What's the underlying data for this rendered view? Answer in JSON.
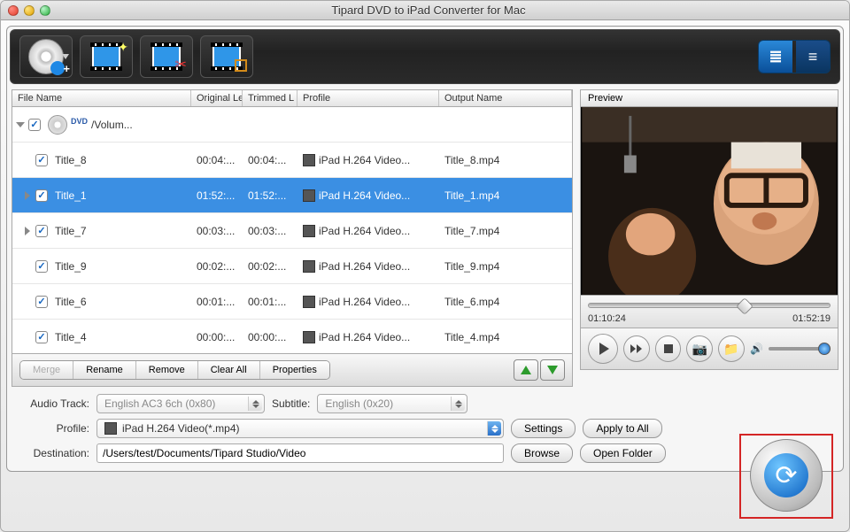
{
  "window": {
    "title": "Tipard DVD to iPad Converter for Mac"
  },
  "columns": {
    "fn": "File Name",
    "ol": "Original Le",
    "tl": "Trimmed L",
    "pf": "Profile",
    "on": "Output Name"
  },
  "parent": {
    "name": "/Volum..."
  },
  "rows": [
    {
      "name": "Title_8",
      "ol": "00:04:...",
      "tl": "00:04:...",
      "pf": "iPad H.264 Video...",
      "on": "Title_8.mp4",
      "sel": false,
      "exp": false
    },
    {
      "name": "Title_1",
      "ol": "01:52:...",
      "tl": "01:52:...",
      "pf": "iPad H.264 Video...",
      "on": "Title_1.mp4",
      "sel": true,
      "exp": true
    },
    {
      "name": "Title_7",
      "ol": "00:03:...",
      "tl": "00:03:...",
      "pf": "iPad H.264 Video...",
      "on": "Title_7.mp4",
      "sel": false,
      "exp": true
    },
    {
      "name": "Title_9",
      "ol": "00:02:...",
      "tl": "00:02:...",
      "pf": "iPad H.264 Video...",
      "on": "Title_9.mp4",
      "sel": false,
      "exp": false
    },
    {
      "name": "Title_6",
      "ol": "00:01:...",
      "tl": "00:01:...",
      "pf": "iPad H.264 Video...",
      "on": "Title_6.mp4",
      "sel": false,
      "exp": false
    },
    {
      "name": "Title_4",
      "ol": "00:00:...",
      "tl": "00:00:...",
      "pf": "iPad H.264 Video...",
      "on": "Title_4.mp4",
      "sel": false,
      "exp": false
    }
  ],
  "actions": {
    "merge": "Merge",
    "rename": "Rename",
    "remove": "Remove",
    "clear": "Clear All",
    "props": "Properties"
  },
  "preview": {
    "label": "Preview",
    "cur": "01:10:24",
    "dur": "01:52:19"
  },
  "form": {
    "audio_label": "Audio Track:",
    "audio_val": "English AC3 6ch (0x80)",
    "subtitle_label": "Subtitle:",
    "subtitle_val": "English (0x20)",
    "profile_label": "Profile:",
    "profile_val": "iPad H.264 Video(*.mp4)",
    "dest_label": "Destination:",
    "dest_val": "/Users/test/Documents/Tipard Studio/Video",
    "settings": "Settings",
    "apply": "Apply to All",
    "browse": "Browse",
    "open": "Open Folder"
  }
}
